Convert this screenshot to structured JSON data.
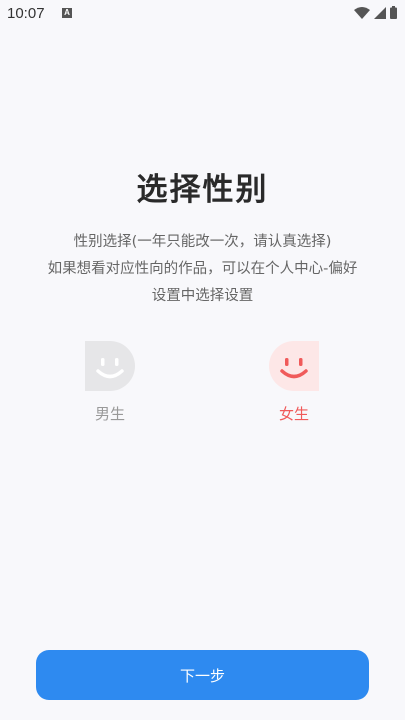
{
  "status_bar": {
    "time": "10:07",
    "notification_letter": "A",
    "icons": [
      "wifi-icon",
      "signal-icon",
      "battery-icon"
    ]
  },
  "title": "选择性别",
  "description": {
    "line1": "性别选择(一年只能改一次，请认真选择)",
    "line2": "如果想看对应性向的作品，可以在个人中心-偏好",
    "line3": "设置中选择设置"
  },
  "genders": {
    "male": {
      "label": "男生",
      "icon": "smiley-face-icon",
      "color": "#999999"
    },
    "female": {
      "label": "女生",
      "icon": "smiley-face-icon",
      "color": "#f05a5a"
    }
  },
  "next_button": {
    "label": "下一步",
    "color": "#2e8af0"
  }
}
